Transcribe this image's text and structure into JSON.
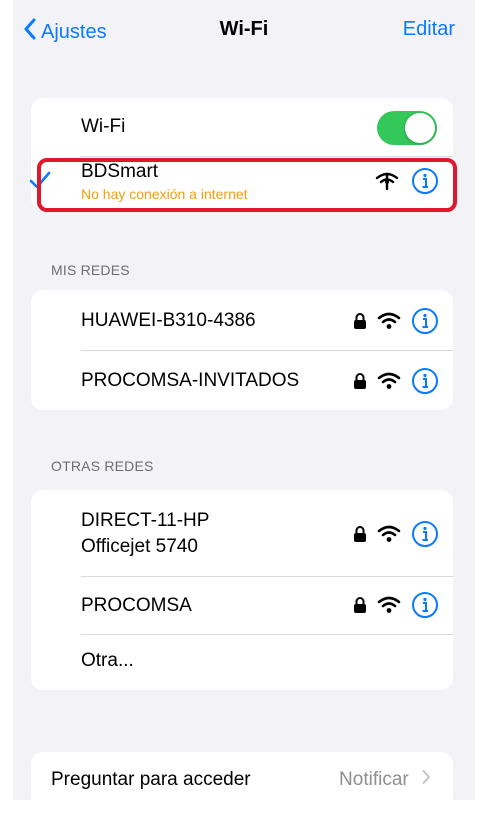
{
  "nav": {
    "back_label": "Ajustes",
    "title": "Wi-Fi",
    "edit_label": "Editar"
  },
  "wifi": {
    "label": "Wi-Fi",
    "enabled": true,
    "toggle_color": "#34c759"
  },
  "current": {
    "name": "BDSmart",
    "status": "No hay conexión a internet",
    "status_color": "#f59e0b",
    "icon": "wifi-no-internet-icon"
  },
  "my_networks": {
    "header": "MIS REDES",
    "items": [
      {
        "name": "HUAWEI-B310-4386",
        "locked": true
      },
      {
        "name": "PROCOMSA-INVITADOS",
        "locked": true
      }
    ]
  },
  "other_networks": {
    "header": "OTRAS REDES",
    "items": [
      {
        "name_line1": "DIRECT-11-HP",
        "name_line2": "Officejet 5740",
        "locked": true
      },
      {
        "name": "PROCOMSA",
        "locked": true
      }
    ],
    "other_label": "Otra..."
  },
  "ask_join": {
    "label": "Preguntar para acceder",
    "value": "Notificar"
  },
  "colors": {
    "accent": "#0a7aff",
    "highlight": "#e0182d",
    "background": "#f2f2f7"
  }
}
